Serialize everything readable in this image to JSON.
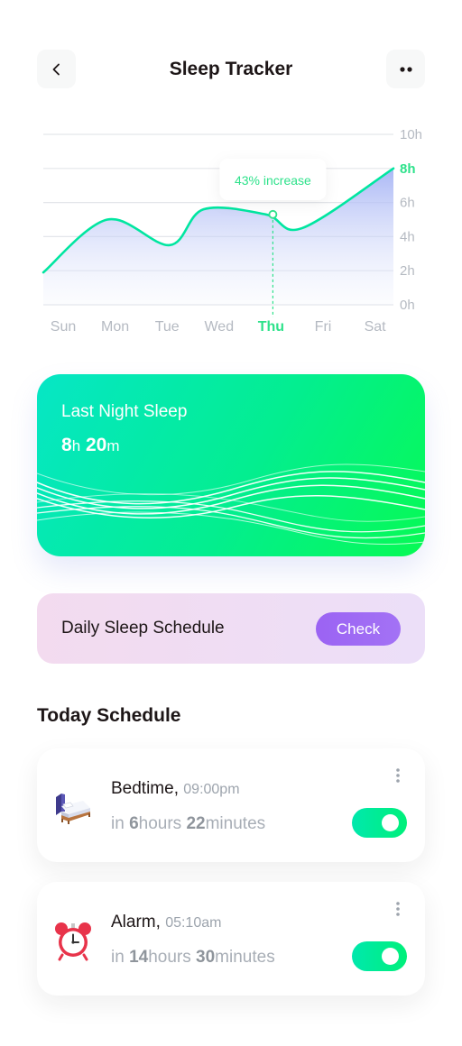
{
  "header": {
    "title": "Sleep Tracker",
    "back_icon": "chevron-left-icon",
    "more_icon": "more-horizontal-icon"
  },
  "chart_data": {
    "type": "area",
    "categories": [
      "Sun",
      "Mon",
      "Tue",
      "Wed",
      "Thu",
      "Fri",
      "Sat"
    ],
    "highlighted_category": "Thu",
    "y_ticks": [
      "10h",
      "8h",
      "6h",
      "4h",
      "2h",
      "0h"
    ],
    "highlighted_tick": "8h",
    "ylim": [
      0,
      10
    ],
    "y_axis_side": "right",
    "grid": true,
    "series": [
      {
        "x": [
          0,
          0.85,
          2.05,
          2.7,
          3.9,
          4.6,
          6.2
        ],
        "y": [
          1.9,
          5.0,
          3.5,
          5.6,
          5.3,
          4.5,
          8.0
        ]
      }
    ],
    "annotation": {
      "category": "Thu",
      "y": 5.3,
      "text": "43% increase"
    },
    "colors": {
      "line": "#00e6a0",
      "highlight": "#2ee28b",
      "fill_top": "#a6b4f5",
      "grid": "#e4e6ea",
      "tick": "#b5bac2"
    }
  },
  "last_night": {
    "title": "Last Night Sleep",
    "hours": "8",
    "hours_unit": "h",
    "minutes": "20",
    "minutes_unit": "m"
  },
  "daily_schedule": {
    "label": "Daily Sleep Schedule",
    "button": "Check"
  },
  "today": {
    "title": "Today Schedule",
    "items": [
      {
        "icon": "bed-icon",
        "title": "Bedtime,",
        "time": "09:00pm",
        "prefix": "in ",
        "hours": "6",
        "hours_unit": "hours ",
        "minutes": "22",
        "minutes_unit": "minutes",
        "enabled": true
      },
      {
        "icon": "alarm-clock-icon",
        "title": "Alarm,",
        "time": "05:10am",
        "prefix": "in ",
        "hours": "14",
        "hours_unit": "hours ",
        "minutes": "30",
        "minutes_unit": "minutes",
        "enabled": true
      }
    ]
  }
}
